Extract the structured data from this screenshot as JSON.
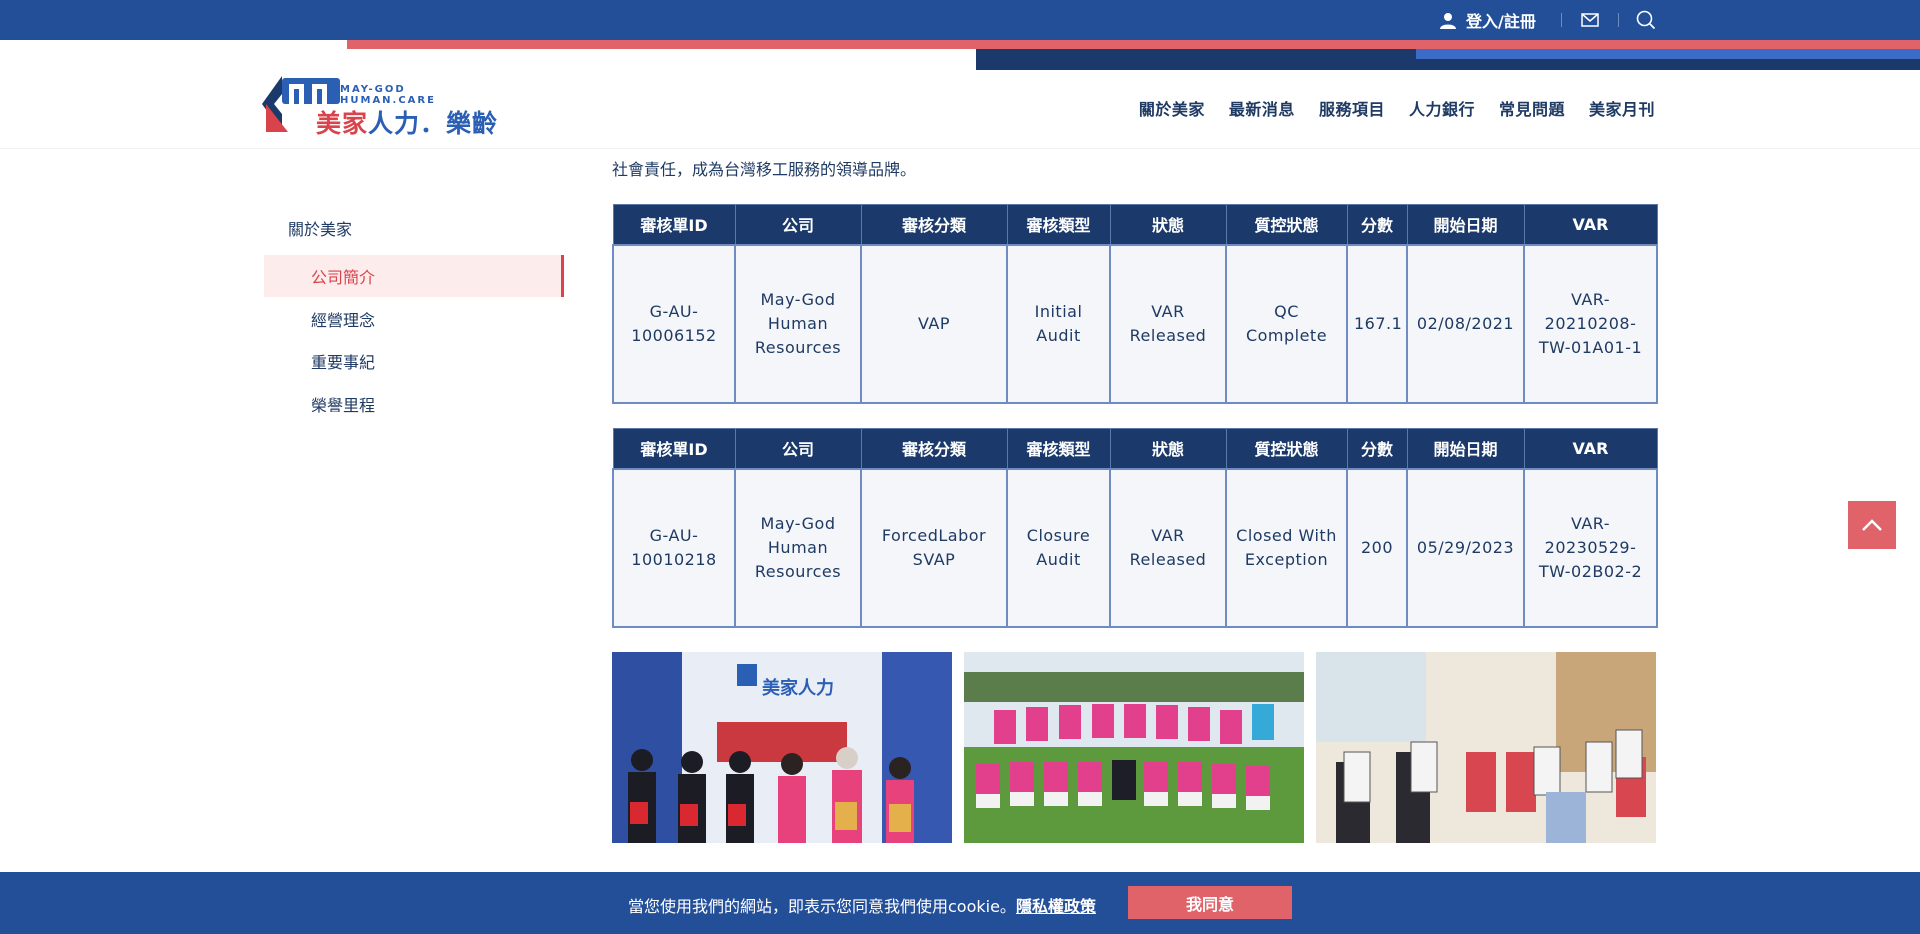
{
  "topbar": {
    "login_label": "登入/註冊",
    "mail_icon": "mail-icon",
    "search_icon": "search-icon"
  },
  "logo": {
    "brand_en_line1": "MAY-GOD",
    "brand_en_line2": "HUMAN.CARE",
    "brand_zh_red": "美家",
    "brand_zh_blue": "人力",
    "brand_zh_tail": "．樂齡"
  },
  "nav": {
    "items": [
      "關於美家",
      "最新消息",
      "服務項目",
      "人力銀行",
      "常見問題",
      "美家月刊"
    ]
  },
  "sidebar": {
    "title": "關於美家",
    "items": [
      {
        "label": "公司簡介"
      },
      {
        "label": "經營理念"
      },
      {
        "label": "重要事紀"
      },
      {
        "label": "榮譽里程"
      }
    ]
  },
  "content": {
    "intro_text": "社會責任，成為台灣移工服務的領導品牌。",
    "table_headers": [
      "審核單ID",
      "公司",
      "審核分類",
      "審核類型",
      "狀態",
      "質控狀態",
      "分數",
      "開始日期",
      "VAR"
    ],
    "tables": [
      {
        "row": [
          [
            "G-AU-",
            "10006152"
          ],
          [
            "May-God",
            "Human",
            "Resources"
          ],
          [
            "VAP"
          ],
          [
            "Initial",
            "Audit"
          ],
          [
            "VAR",
            "Released"
          ],
          [
            "QC",
            "Complete"
          ],
          [
            "167.1"
          ],
          [
            "02/08/2021"
          ],
          [
            "VAR-",
            "20210208-",
            "TW-01A01-1"
          ]
        ]
      },
      {
        "row": [
          [
            "G-AU-",
            "10010218"
          ],
          [
            "May-God",
            "Human",
            "Resources"
          ],
          [
            "ForcedLabor",
            "SVAP"
          ],
          [
            "Closure",
            "Audit"
          ],
          [
            "VAR",
            "Released"
          ],
          [
            "Closed With",
            "Exception"
          ],
          [
            "200"
          ],
          [
            "05/29/2023"
          ],
          [
            "VAR-",
            "20230529-",
            "TW-02B02-2"
          ]
        ]
      }
    ],
    "photos": [
      {
        "name": "photo-team-booth"
      },
      {
        "name": "photo-soccer-team"
      },
      {
        "name": "photo-group-event"
      }
    ],
    "photo1_banner_zh": "美家人力"
  },
  "cookie": {
    "message": "當您使用我們的網站，即表示您同意我們使用cookie。",
    "policy_link": "隱私權政策",
    "agree_label": "我同意"
  },
  "colors": {
    "primary_blue": "#234f99",
    "navy": "#1b3a6b",
    "accent_red": "#e06369"
  }
}
